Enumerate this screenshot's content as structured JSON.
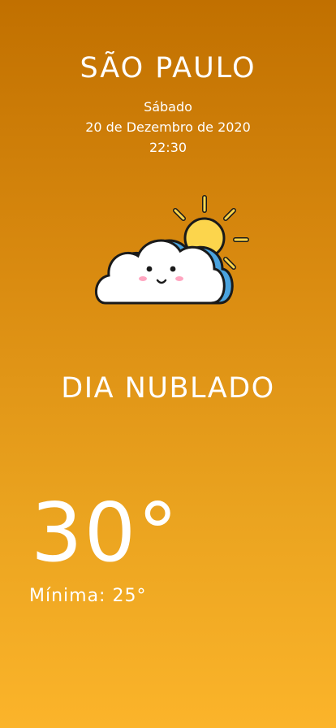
{
  "location": {
    "city": "SÃO PAULO"
  },
  "date": {
    "weekday": "Sábado",
    "full_date": "20 de Dezembro de 2020",
    "time": "22:30"
  },
  "weather": {
    "icon": "partly-cloudy-icon",
    "condition": "DIA NUBLADO",
    "temperature": "30°",
    "min_temperature": "Mínima: 25°"
  },
  "colors": {
    "background_top": "#c17000",
    "background_bottom": "#fbb42a",
    "text": "#ffffff",
    "sun": "#fcd54c",
    "cloud_shadow": "#4aa3df"
  }
}
